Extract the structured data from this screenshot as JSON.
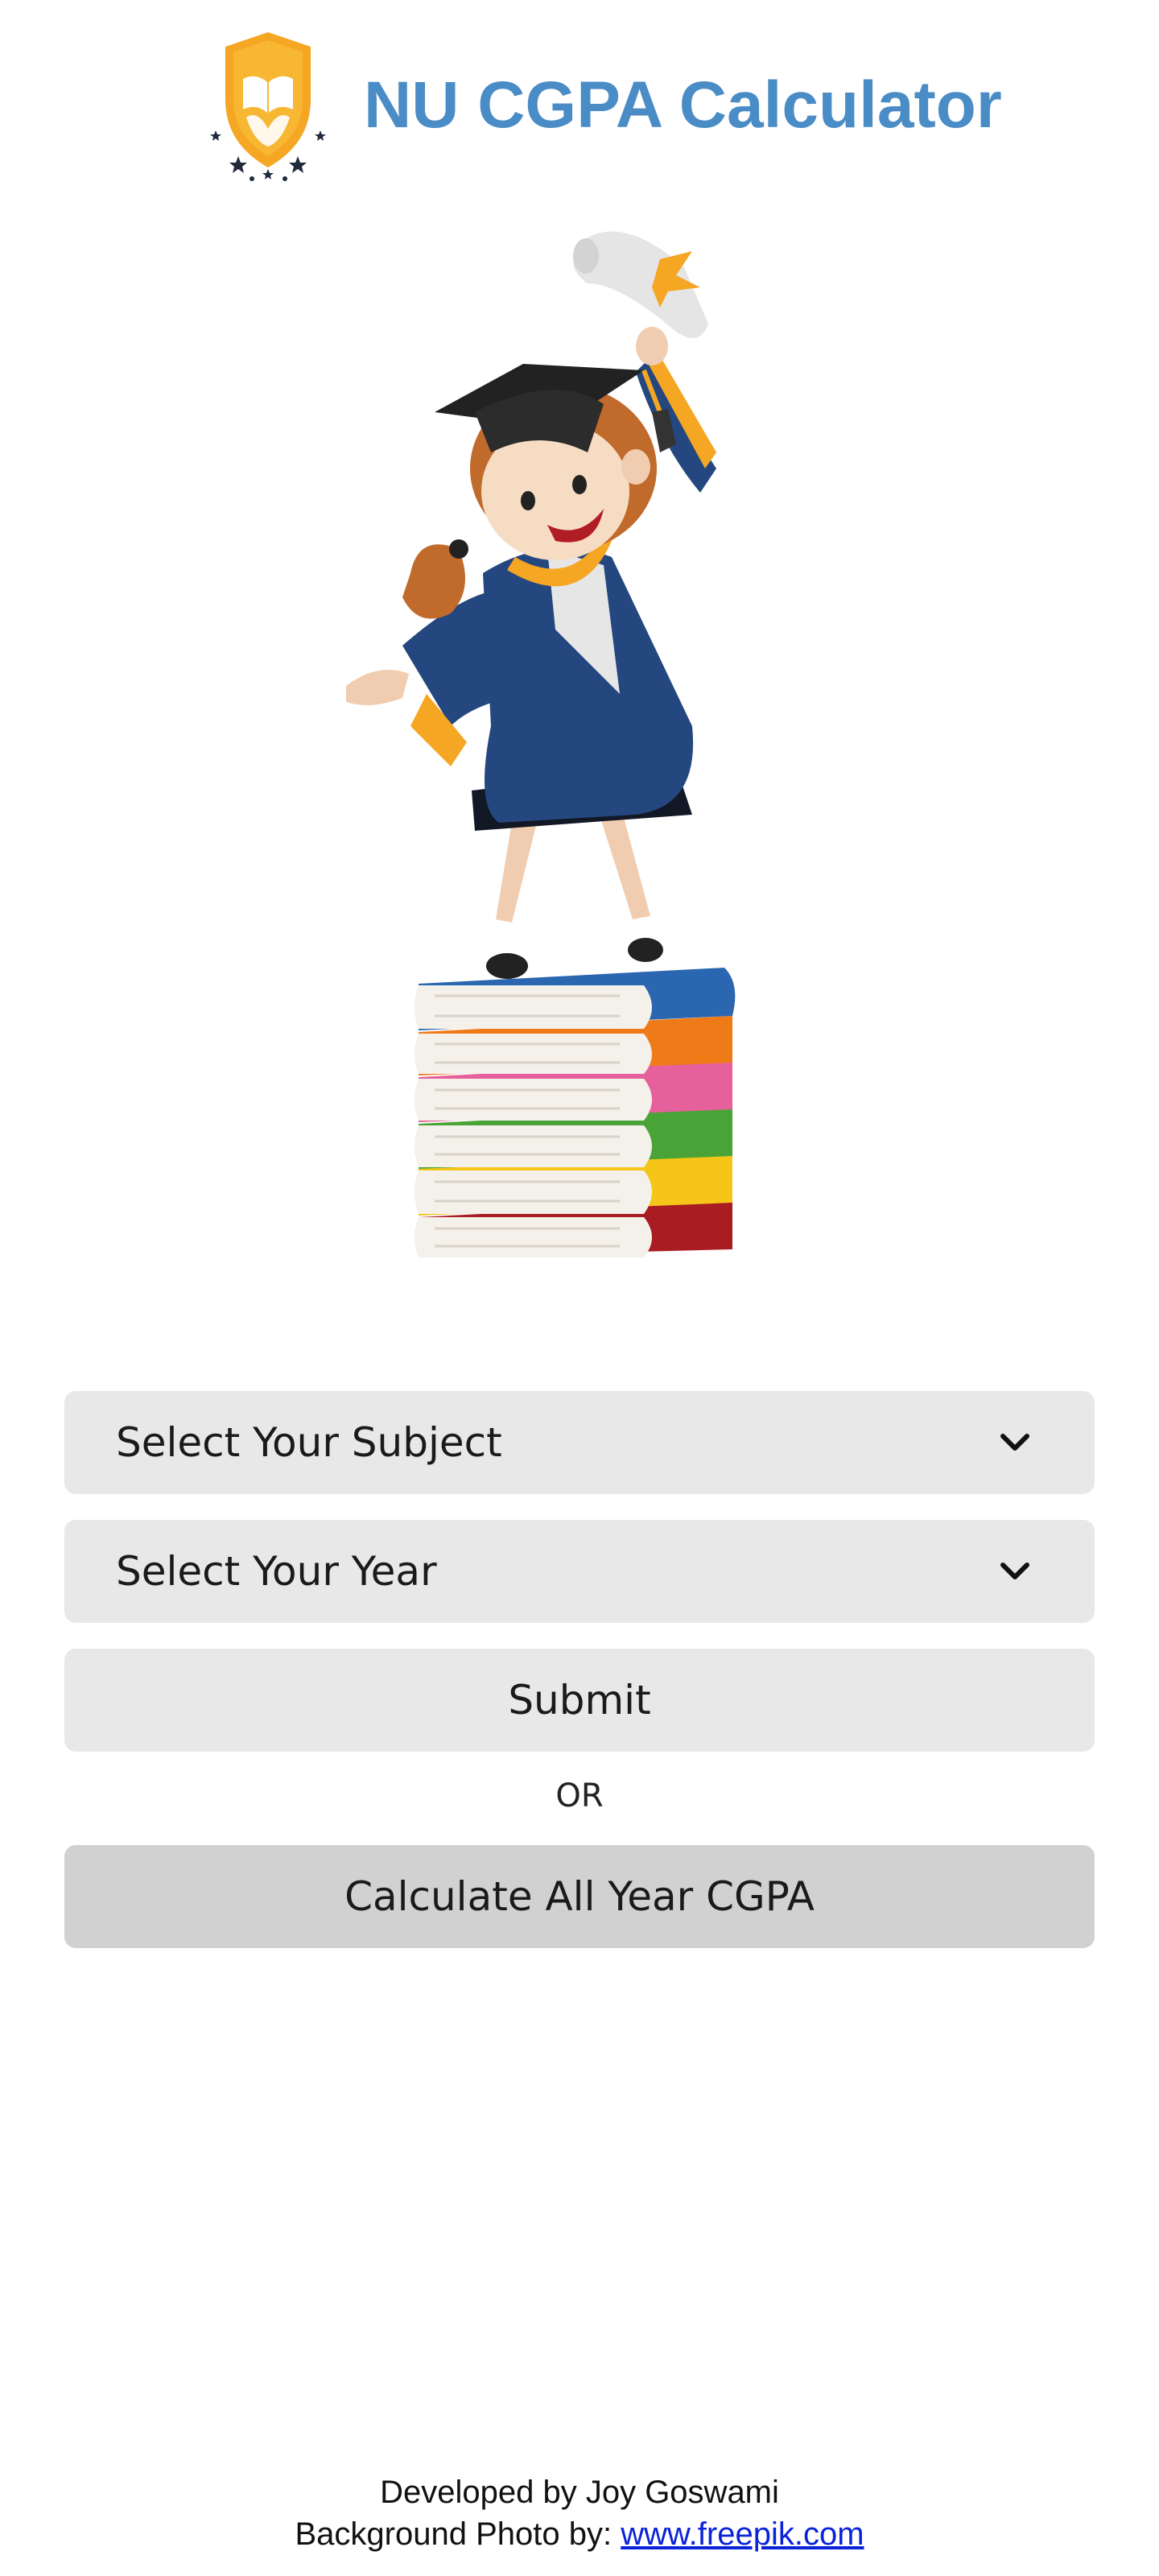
{
  "header": {
    "title": "NU CGPA Calculator",
    "logo_icon": "graduation-shield-logo-icon"
  },
  "hero": {
    "illustration_icon": "graduate-girl-on-books-illustration"
  },
  "form": {
    "subject_select": {
      "label": "Select Your Subject",
      "icon": "chevron-down-icon"
    },
    "year_select": {
      "label": "Select Your Year",
      "icon": "chevron-down-icon"
    },
    "submit_label": "Submit",
    "or_text": "OR",
    "all_year_label": "Calculate All Year CGPA"
  },
  "footer": {
    "developer_line": "Developed by Joy Goswami",
    "photo_credit_prefix": "Background Photo by: ",
    "photo_credit_link": "www.freepik.com"
  },
  "colors": {
    "title": "#4a8cc6",
    "control_bg": "#e8e8e8",
    "all_year_bg": "#d1d1d1",
    "link": "#0b23d8",
    "logo_gold": "#f5a623"
  }
}
